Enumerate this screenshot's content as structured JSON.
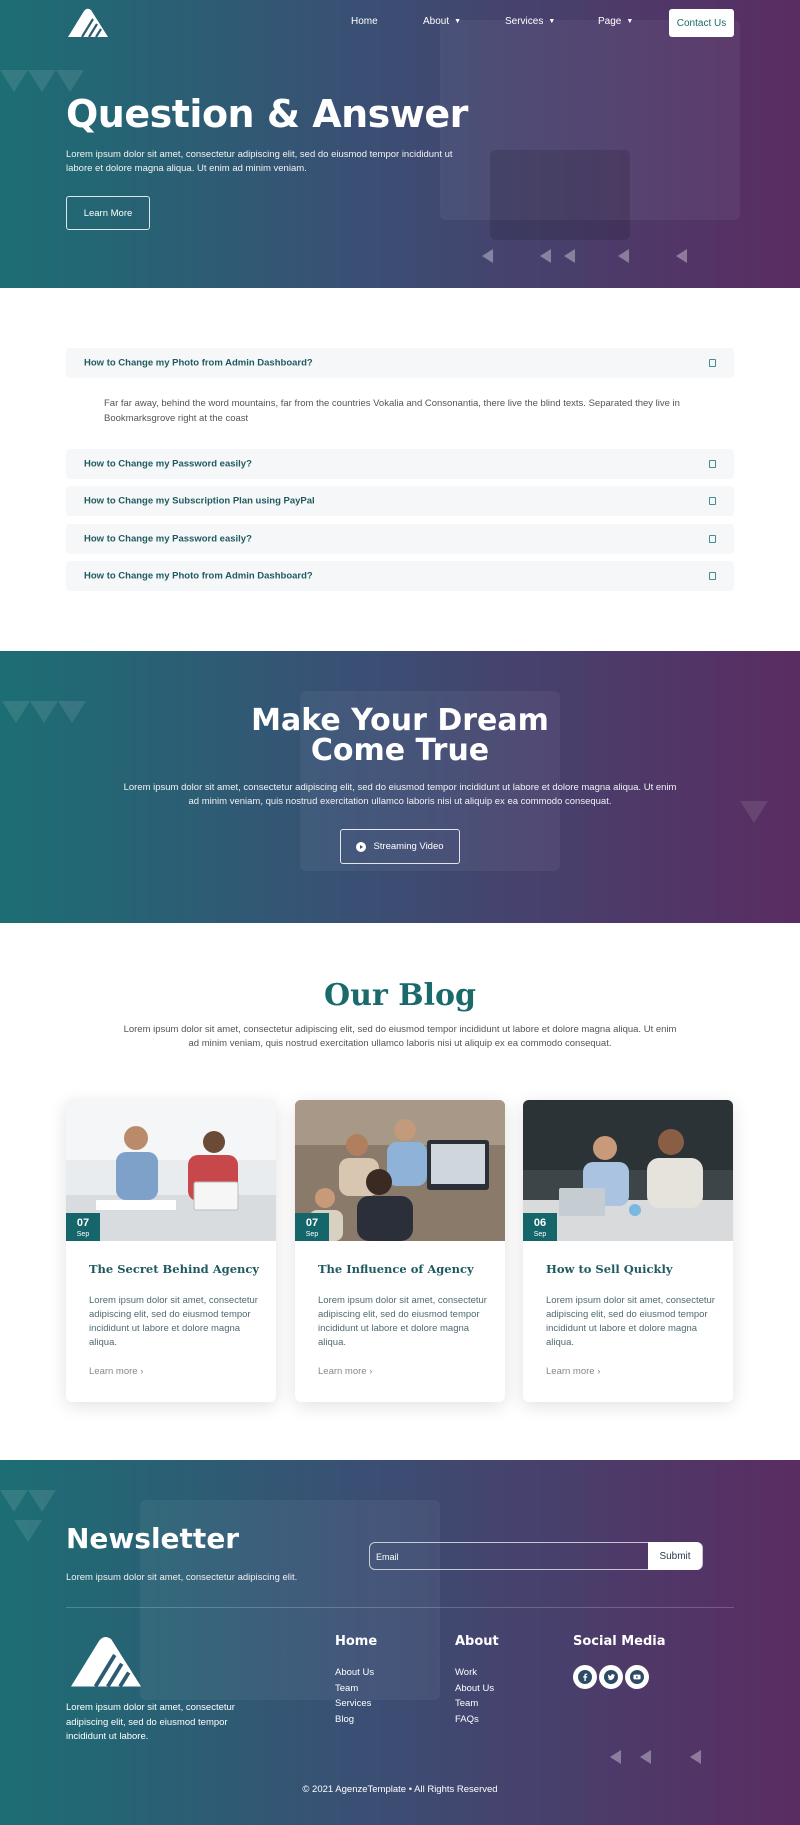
{
  "nav": {
    "items": [
      {
        "label": "Home"
      },
      {
        "label": "About"
      },
      {
        "label": "Services"
      },
      {
        "label": "Page"
      }
    ],
    "contact_label": "Contact Us"
  },
  "hero": {
    "title": "Question & Answer",
    "text": "Lorem ipsum dolor sit amet, consectetur adipiscing elit, sed do eiusmod tempor incididunt ut labore et dolore magna aliqua. Ut enim ad minim veniam.",
    "button_label": "Learn More"
  },
  "faq": {
    "items": [
      {
        "question": "How to Change my Photo from Admin Dashboard?",
        "answer": "Far far away, behind the word mountains, far from the countries Vokalia and Consonantia, there live the blind texts. Separated they live in Bookmarksgrove right at the coast"
      },
      {
        "question": "How to Change my Password easily?"
      },
      {
        "question": "How to Change my Subscription Plan using PayPal"
      },
      {
        "question": "How to Change my Password easily?"
      },
      {
        "question": "How to Change my Photo from Admin Dashboard?"
      }
    ]
  },
  "dream": {
    "title_line1": "Make Your Dream",
    "title_line2": "Come True",
    "text": "Lorem ipsum dolor sit amet, consectetur adipiscing elit, sed do eiusmod tempor incididunt ut labore et dolore magna aliqua. Ut enim ad minim veniam, quis nostrud exercitation ullamco laboris nisi ut aliquip ex ea commodo consequat.",
    "button_label": "Streaming Video"
  },
  "blog": {
    "title": "Our Blog",
    "text": "Lorem ipsum dolor sit amet, consectetur adipiscing elit, sed do eiusmod tempor incididunt ut labore et dolore magna aliqua. Ut enim ad minim veniam, quis nostrud exercitation ullamco laboris nisi ut aliquip ex ea commodo consequat.",
    "posts": [
      {
        "day": "07",
        "month": "Sep",
        "title": "The Secret Behind Agency",
        "text": "Lorem ipsum dolor sit amet, consectetur adipiscing elit, sed do eiusmod tempor incididunt ut labore et dolore magna aliqua.",
        "more": "Learn more"
      },
      {
        "day": "07",
        "month": "Sep",
        "title": "The Influence of Agency",
        "text": "Lorem ipsum dolor sit amet, consectetur adipiscing elit, sed do eiusmod tempor incididunt ut labore et dolore magna aliqua.",
        "more": "Learn more"
      },
      {
        "day": "06",
        "month": "Sep",
        "title": "How to Sell Quickly",
        "text": "Lorem ipsum dolor sit amet, consectetur adipiscing elit, sed do eiusmod tempor incididunt ut labore et dolore magna aliqua.",
        "more": "Learn more"
      }
    ]
  },
  "newsletter": {
    "title": "Newsletter",
    "text": "Lorem ipsum dolor sit amet, consectetur adipiscing elit.",
    "email_placeholder": "Email",
    "submit_label": "Submit"
  },
  "footer": {
    "about": "Lorem ipsum dolor sit amet, consectetur adipiscing elit, sed do eiusmod tempor incididunt ut labore.",
    "columns": [
      {
        "heading": "Home",
        "links": [
          "About Us",
          "Team",
          "Services",
          "Blog"
        ]
      },
      {
        "heading": "About",
        "links": [
          "Work",
          "About Us",
          "Team",
          "FAQs"
        ]
      }
    ],
    "social_heading": "Social Media",
    "social_icons": [
      "facebook-icon",
      "twitter-icon",
      "youtube-icon"
    ],
    "copyright": "© 2021 AgenzeTemplate • All Rights Reserved"
  },
  "colors": {
    "primary": "#14666a",
    "gradient_start": "#1c6e74",
    "gradient_end": "#5a2c62",
    "faq_bg": "#f5f7f8",
    "heading_teal": "#1a6a6c"
  }
}
